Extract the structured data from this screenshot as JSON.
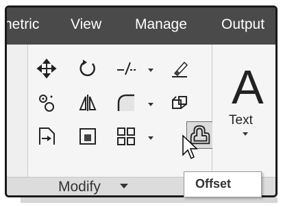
{
  "tabs": [
    {
      "label": "netric"
    },
    {
      "label": "View"
    },
    {
      "label": "Manage"
    },
    {
      "label": "Output"
    }
  ],
  "modify_panel": {
    "title": "Modify",
    "tools": [
      {
        "name": "move",
        "icon": "move-icon"
      },
      {
        "name": "rotate",
        "icon": "rotate-icon"
      },
      {
        "name": "trim-extend",
        "icon": "trim-icon",
        "dropdown": true
      },
      {
        "name": "erase",
        "icon": "erase-icon"
      },
      {
        "name": "copy",
        "icon": "copy-icon"
      },
      {
        "name": "mirror",
        "icon": "mirror-icon"
      },
      {
        "name": "fillet",
        "icon": "fillet-icon",
        "dropdown": true
      },
      {
        "name": "explode",
        "icon": "explode-icon"
      },
      {
        "name": "stretch",
        "icon": "stretch-icon"
      },
      {
        "name": "scale",
        "icon": "scale-icon"
      },
      {
        "name": "array",
        "icon": "array-icon",
        "dropdown": true
      },
      {
        "name": "offset",
        "icon": "offset-icon",
        "highlighted": true
      }
    ]
  },
  "annotation_panel": {
    "big_glyph": "A",
    "text_label": "Text",
    "title_fragment": "A"
  },
  "tooltip": {
    "label": "Offset"
  },
  "colors": {
    "tabbar": "#4a4a4a",
    "ribbon": "#f2f2f2",
    "panel_title_bar": "#dcdcdc"
  }
}
